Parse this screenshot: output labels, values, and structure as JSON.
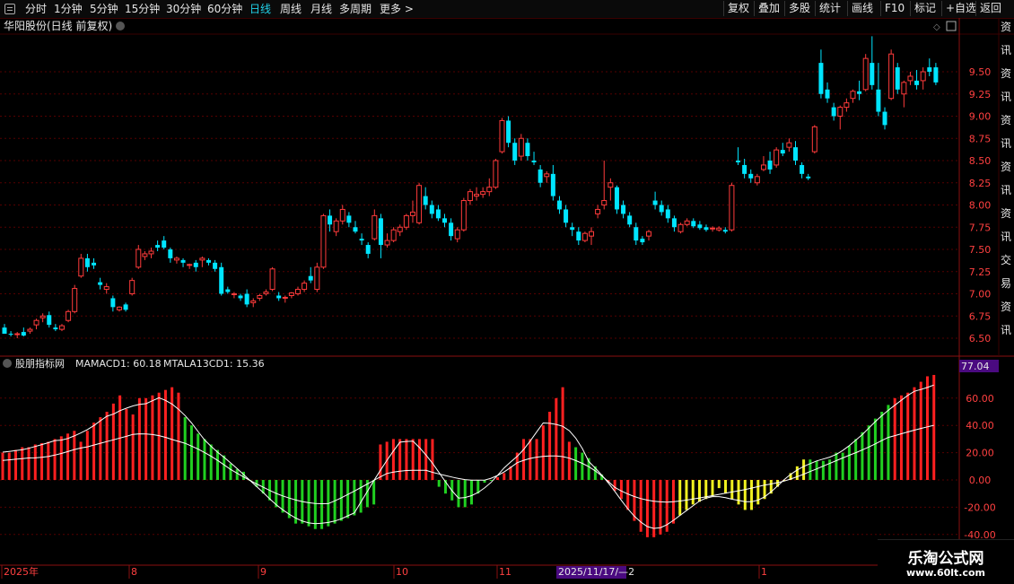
{
  "toolbar": {
    "menu_icon": "hamburger-icon",
    "periods": [
      "分时",
      "1分钟",
      "5分钟",
      "15分钟",
      "30分钟",
      "60分钟",
      "日线",
      "周线",
      "月线",
      "多周期",
      "更多 >"
    ],
    "active_period": "日线",
    "right_buttons": [
      "复权",
      "叠加",
      "多股",
      "统计",
      "画线",
      "F10",
      "标记",
      "+自选",
      "返回"
    ]
  },
  "stock": {
    "title": "华阳股份(日线 前复权)",
    "price_axis": [
      "9.50",
      "9.25",
      "9.00",
      "8.75",
      "8.50",
      "8.25",
      "8.00",
      "7.75",
      "7.50",
      "7.25",
      "7.00",
      "6.75",
      "6.50"
    ]
  },
  "indicator": {
    "name": "股朋指标网",
    "mamacd_label": "MAMACD1: 60.18",
    "mtala_label": "MTALA13CD1: 15.36",
    "current_badge": "77.04",
    "axis": [
      "60.00",
      "40.00",
      "20.00",
      "0.00",
      "-20.00",
      "-40.00"
    ]
  },
  "date_axis": {
    "labels": [
      "2025年",
      "8",
      "9",
      "10",
      "11",
      "1"
    ],
    "highlight": "2025/11/17/—2"
  },
  "right_panel_chars": "资讯资讯资讯资讯资讯交易资讯",
  "watermark": {
    "name": "乐淘公式网",
    "url": "www.60lt.com"
  },
  "colors": {
    "up": "#ff3b3b",
    "down": "#00e5ff",
    "bar_red": "#ff2020",
    "bar_green": "#20d020",
    "bar_yellow": "#f0f020",
    "grid": "#550000",
    "text": "#e6e6e6",
    "axis_red": "#ff4040",
    "badge": "#4a0a80"
  },
  "chart_data": {
    "type": "candlestick",
    "candles": [
      [
        6.62,
        6.66,
        6.55,
        6.55
      ],
      [
        6.55,
        6.58,
        6.52,
        6.54
      ],
      [
        6.54,
        6.57,
        6.5,
        6.55
      ],
      [
        6.57,
        6.62,
        6.52,
        6.53
      ],
      [
        6.58,
        6.62,
        6.55,
        6.6
      ],
      [
        6.65,
        6.72,
        6.6,
        6.7
      ],
      [
        6.73,
        6.78,
        6.68,
        6.75
      ],
      [
        6.76,
        6.8,
        6.62,
        6.65
      ],
      [
        6.62,
        6.66,
        6.58,
        6.6
      ],
      [
        6.6,
        6.66,
        6.58,
        6.64
      ],
      [
        6.7,
        6.82,
        6.68,
        6.8
      ],
      [
        6.8,
        7.1,
        6.78,
        7.06
      ],
      [
        7.2,
        7.45,
        7.18,
        7.4
      ],
      [
        7.4,
        7.45,
        7.25,
        7.3
      ],
      [
        7.35,
        7.4,
        7.28,
        7.32
      ],
      [
        7.13,
        7.18,
        7.05,
        7.1
      ],
      [
        7.05,
        7.12,
        7.0,
        7.08
      ],
      [
        6.95,
        6.98,
        6.8,
        6.85
      ],
      [
        6.82,
        6.86,
        6.8,
        6.85
      ],
      [
        6.88,
        6.9,
        6.8,
        6.82
      ],
      [
        7.0,
        7.18,
        6.98,
        7.15
      ],
      [
        7.3,
        7.55,
        7.28,
        7.5
      ],
      [
        7.42,
        7.48,
        7.38,
        7.45
      ],
      [
        7.45,
        7.52,
        7.4,
        7.48
      ],
      [
        7.55,
        7.6,
        7.48,
        7.52
      ],
      [
        7.6,
        7.65,
        7.5,
        7.52
      ],
      [
        7.5,
        7.52,
        7.35,
        7.4
      ],
      [
        7.38,
        7.42,
        7.34,
        7.4
      ],
      [
        7.38,
        7.4,
        7.3,
        7.35
      ],
      [
        7.32,
        7.34,
        7.28,
        7.33
      ],
      [
        7.35,
        7.38,
        7.25,
        7.3
      ],
      [
        7.38,
        7.42,
        7.3,
        7.4
      ],
      [
        7.38,
        7.4,
        7.32,
        7.35
      ],
      [
        7.35,
        7.38,
        7.25,
        7.28
      ],
      [
        7.3,
        7.35,
        6.98,
        7.0
      ],
      [
        7.05,
        7.08,
        7.0,
        7.02
      ],
      [
        7.0,
        7.02,
        6.95,
        7.0
      ],
      [
        6.98,
        7.0,
        6.92,
        6.95
      ],
      [
        7.0,
        7.05,
        6.85,
        6.88
      ],
      [
        6.9,
        6.95,
        6.85,
        6.92
      ],
      [
        6.95,
        7.0,
        6.92,
        6.98
      ],
      [
        7.0,
        7.05,
        6.98,
        7.02
      ],
      [
        7.05,
        7.3,
        7.03,
        7.28
      ],
      [
        6.98,
        7.02,
        6.92,
        6.95
      ],
      [
        6.95,
        6.98,
        6.9,
        6.96
      ],
      [
        6.98,
        7.02,
        6.95,
        7.01
      ],
      [
        7.0,
        7.08,
        6.98,
        7.05
      ],
      [
        7.05,
        7.15,
        7.02,
        7.12
      ],
      [
        7.2,
        7.3,
        7.12,
        7.15
      ],
      [
        7.05,
        7.35,
        7.02,
        7.3
      ],
      [
        7.3,
        7.9,
        7.28,
        7.88
      ],
      [
        7.88,
        7.95,
        7.7,
        7.78
      ],
      [
        7.7,
        7.85,
        7.65,
        7.82
      ],
      [
        7.82,
        8.0,
        7.78,
        7.95
      ],
      [
        7.88,
        7.92,
        7.75,
        7.8
      ],
      [
        7.75,
        7.82,
        7.68,
        7.7
      ],
      [
        7.62,
        7.68,
        7.55,
        7.6
      ],
      [
        7.55,
        7.58,
        7.4,
        7.45
      ],
      [
        7.62,
        7.95,
        7.6,
        7.88
      ],
      [
        7.85,
        7.9,
        7.4,
        7.55
      ],
      [
        7.55,
        7.68,
        7.52,
        7.6
      ],
      [
        7.6,
        7.75,
        7.58,
        7.72
      ],
      [
        7.7,
        7.78,
        7.65,
        7.75
      ],
      [
        7.75,
        7.9,
        7.72,
        7.88
      ],
      [
        7.88,
        8.05,
        7.8,
        7.92
      ],
      [
        7.8,
        8.25,
        7.78,
        8.22
      ],
      [
        8.1,
        8.2,
        7.95,
        8.0
      ],
      [
        8.0,
        8.05,
        7.85,
        7.9
      ],
      [
        7.95,
        8.0,
        7.82,
        7.85
      ],
      [
        7.85,
        7.9,
        7.75,
        7.8
      ],
      [
        7.8,
        7.85,
        7.6,
        7.65
      ],
      [
        7.62,
        7.75,
        7.58,
        7.72
      ],
      [
        7.72,
        8.08,
        7.7,
        8.05
      ],
      [
        8.05,
        8.18,
        8.0,
        8.15
      ],
      [
        8.1,
        8.2,
        8.05,
        8.12
      ],
      [
        8.12,
        8.2,
        8.08,
        8.15
      ],
      [
        8.15,
        8.3,
        8.1,
        8.2
      ],
      [
        8.2,
        8.52,
        8.18,
        8.5
      ],
      [
        8.6,
        8.98,
        8.58,
        8.95
      ],
      [
        8.95,
        9.0,
        8.65,
        8.7
      ],
      [
        8.7,
        8.75,
        8.45,
        8.5
      ],
      [
        8.55,
        8.8,
        8.5,
        8.75
      ],
      [
        8.7,
        8.75,
        8.5,
        8.55
      ],
      [
        8.5,
        8.6,
        8.45,
        8.48
      ],
      [
        8.4,
        8.45,
        8.2,
        8.25
      ],
      [
        8.32,
        8.38,
        8.25,
        8.35
      ],
      [
        8.35,
        8.45,
        8.05,
        8.1
      ],
      [
        8.05,
        8.1,
        7.9,
        7.95
      ],
      [
        7.95,
        8.0,
        7.75,
        7.8
      ],
      [
        7.75,
        7.8,
        7.65,
        7.72
      ],
      [
        7.7,
        7.75,
        7.55,
        7.6
      ],
      [
        7.6,
        7.7,
        7.58,
        7.68
      ],
      [
        7.65,
        7.75,
        7.55,
        7.7
      ],
      [
        7.9,
        8.0,
        7.85,
        7.95
      ],
      [
        8.0,
        8.5,
        7.95,
        8.05
      ],
      [
        8.2,
        8.3,
        8.05,
        8.25
      ],
      [
        8.2,
        8.22,
        7.9,
        7.95
      ],
      [
        8.0,
        8.05,
        7.85,
        7.9
      ],
      [
        7.88,
        7.92,
        7.75,
        7.78
      ],
      [
        7.75,
        7.8,
        7.55,
        7.6
      ],
      [
        7.62,
        7.65,
        7.55,
        7.58
      ],
      [
        7.65,
        7.72,
        7.6,
        7.7
      ],
      [
        8.05,
        8.15,
        7.95,
        8.0
      ],
      [
        8.0,
        8.05,
        7.88,
        7.92
      ],
      [
        7.95,
        8.0,
        7.8,
        7.85
      ],
      [
        7.85,
        7.88,
        7.7,
        7.75
      ],
      [
        7.7,
        7.8,
        7.68,
        7.78
      ],
      [
        7.78,
        7.85,
        7.76,
        7.82
      ],
      [
        7.82,
        7.85,
        7.74,
        7.76
      ],
      [
        7.78,
        7.82,
        7.72,
        7.74
      ],
      [
        7.75,
        7.78,
        7.7,
        7.72
      ],
      [
        7.73,
        7.76,
        7.7,
        7.74
      ],
      [
        7.72,
        7.76,
        7.7,
        7.74
      ],
      [
        7.72,
        7.75,
        7.68,
        7.7
      ],
      [
        7.72,
        8.25,
        7.7,
        8.22
      ],
      [
        8.5,
        8.65,
        8.45,
        8.48
      ],
      [
        8.45,
        8.52,
        8.3,
        8.35
      ],
      [
        8.35,
        8.4,
        8.25,
        8.3
      ],
      [
        8.25,
        8.35,
        8.22,
        8.32
      ],
      [
        8.4,
        8.55,
        8.38,
        8.45
      ],
      [
        8.5,
        8.6,
        8.35,
        8.4
      ],
      [
        8.45,
        8.65,
        8.42,
        8.62
      ],
      [
        8.62,
        8.7,
        8.55,
        8.58
      ],
      [
        8.65,
        8.75,
        8.6,
        8.7
      ],
      [
        8.65,
        8.72,
        8.45,
        8.5
      ],
      [
        8.45,
        8.48,
        8.3,
        8.35
      ],
      [
        8.32,
        8.35,
        8.28,
        8.3
      ],
      [
        8.6,
        8.9,
        8.58,
        8.88
      ],
      [
        9.6,
        9.75,
        9.2,
        9.25
      ],
      [
        9.3,
        9.38,
        9.15,
        9.2
      ],
      [
        9.1,
        9.15,
        8.95,
        9.0
      ],
      [
        9.0,
        9.12,
        8.85,
        9.1
      ],
      [
        9.1,
        9.2,
        9.05,
        9.15
      ],
      [
        9.2,
        9.3,
        9.15,
        9.28
      ],
      [
        9.28,
        9.4,
        9.18,
        9.25
      ],
      [
        9.3,
        9.7,
        9.28,
        9.65
      ],
      [
        9.6,
        9.9,
        9.3,
        9.35
      ],
      [
        9.3,
        9.6,
        9.0,
        9.05
      ],
      [
        9.05,
        9.1,
        8.85,
        8.9
      ],
      [
        9.2,
        9.75,
        9.18,
        9.7
      ],
      [
        9.55,
        9.6,
        9.25,
        9.3
      ],
      [
        9.25,
        9.4,
        9.1,
        9.38
      ],
      [
        9.4,
        9.5,
        9.35,
        9.45
      ],
      [
        9.4,
        9.52,
        9.3,
        9.35
      ],
      [
        9.4,
        9.55,
        9.3,
        9.5
      ],
      [
        9.55,
        9.65,
        9.45,
        9.5
      ],
      [
        9.55,
        9.6,
        9.35,
        9.38
      ]
    ],
    "mamacd_values": [
      20,
      20,
      22,
      24,
      24,
      26,
      27,
      28,
      30,
      32,
      34,
      36,
      28,
      36,
      42,
      46,
      50,
      56,
      62,
      52,
      48,
      60,
      60,
      62,
      64,
      66,
      68,
      64,
      46,
      40,
      34,
      30,
      26,
      22,
      18,
      12,
      8,
      6,
      0,
      -5,
      -10,
      -15,
      -20,
      -24,
      -28,
      -32,
      -32,
      -34,
      -36,
      -36,
      -34,
      -32,
      -30,
      -28,
      -26,
      -24,
      -20,
      -18,
      26,
      28,
      30,
      30,
      30,
      30,
      30,
      30,
      30,
      -5,
      -10,
      -15,
      -20,
      -20,
      -18,
      -10,
      -2,
      0,
      2,
      5,
      10,
      20,
      30,
      30,
      30,
      40,
      50,
      60,
      68,
      28,
      24,
      20,
      16,
      10,
      4,
      -2,
      -8,
      -14,
      -22,
      -30,
      -38,
      -42,
      -42,
      -40,
      -38,
      -32,
      -26,
      -22,
      -18,
      -16,
      -14,
      -12,
      -6,
      -10,
      -14,
      -18,
      -22,
      -22,
      -18,
      -14,
      -10,
      -5,
      0,
      5,
      10,
      15,
      15,
      14,
      14,
      15,
      20,
      20,
      25,
      30,
      35,
      40,
      45,
      50,
      55,
      60,
      62,
      64,
      68,
      72,
      76,
      77
    ]
  }
}
